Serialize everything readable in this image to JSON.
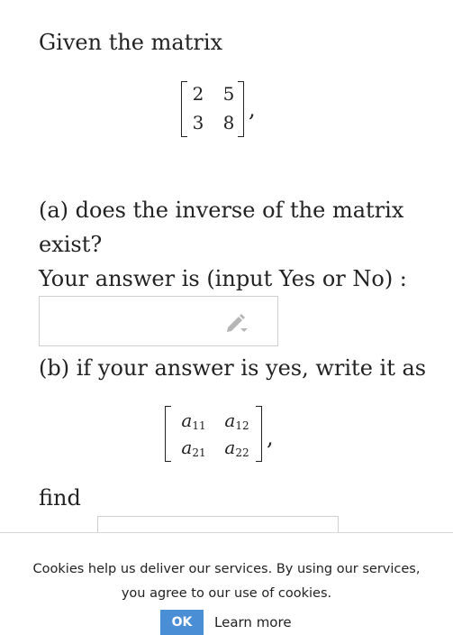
{
  "question": {
    "intro": "Given the matrix",
    "matrix_a": [
      [
        "2",
        "5"
      ],
      [
        "3",
        "8"
      ]
    ],
    "matrix_a_suffix": ",",
    "part_a_line1": "(a) does the inverse of the matrix",
    "part_a_line2": "exist?",
    "answer_prompt": "Your answer is (input Yes or No) :",
    "answer_value": "",
    "part_b": "(b) if your answer is yes, write it as",
    "matrix_b": [
      [
        {
          "base": "a",
          "sub": "11"
        },
        {
          "base": "a",
          "sub": "12"
        }
      ],
      [
        {
          "base": "a",
          "sub": "21"
        },
        {
          "base": "a",
          "sub": "22"
        }
      ]
    ],
    "matrix_b_suffix": ",",
    "find_label": "find"
  },
  "icons": {
    "edit": "pencil-icon"
  },
  "cookie": {
    "message_line1": "Cookies help us deliver our services. By using our services,",
    "message_line2": "you agree to our use of cookies.",
    "ok_label": "OK",
    "learn_more_label": "Learn more"
  },
  "colors": {
    "ok_button": "#4a8fd6"
  }
}
